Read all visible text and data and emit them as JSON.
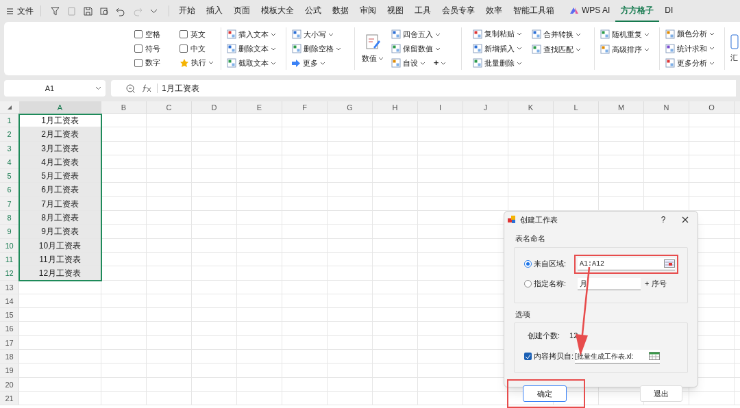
{
  "menu": {
    "file": "文件",
    "tabs": [
      {
        "label": "开始",
        "selected": false
      },
      {
        "label": "插入",
        "selected": false
      },
      {
        "label": "页面",
        "selected": false
      },
      {
        "label": "模板大全",
        "selected": false
      },
      {
        "label": "公式",
        "selected": false
      },
      {
        "label": "数据",
        "selected": false
      },
      {
        "label": "审阅",
        "selected": false
      },
      {
        "label": "视图",
        "selected": false
      },
      {
        "label": "工具",
        "selected": false
      },
      {
        "label": "会员专享",
        "selected": false
      },
      {
        "label": "效率",
        "selected": false
      },
      {
        "label": "智能工具箱",
        "selected": false
      },
      {
        "label": "WPS AI",
        "selected": false
      },
      {
        "label": "方方格子",
        "selected": true
      },
      {
        "label": "DI",
        "selected": false
      }
    ]
  },
  "ribbon": {
    "checkboxes": [
      {
        "label": "空格",
        "checked": false
      },
      {
        "label": "符号",
        "checked": false
      },
      {
        "label": "数字",
        "checked": false
      },
      {
        "label": "英文",
        "checked": false
      },
      {
        "label": "中文",
        "checked": false
      }
    ],
    "execute": "执行",
    "text_tools": [
      [
        "插入文本",
        "删除文本",
        "截取文本"
      ],
      [
        "大小写",
        "删除空格",
        "更多"
      ]
    ],
    "number_button": "数值",
    "number_tools": [
      "四舍五入",
      "保留数值",
      "自设"
    ],
    "plus": "+",
    "edit_tools": [
      [
        "复制粘贴",
        "新增插入",
        "批量删除"
      ],
      [
        "合并转换",
        "查找匹配"
      ],
      [
        "随机重复",
        "高级排序"
      ],
      [
        "颜色分析",
        "统计求和",
        "更多分析"
      ]
    ],
    "summary": "汇"
  },
  "formula_bar": {
    "name_box": "A1",
    "formula": "1月工资表"
  },
  "sheet": {
    "columns": [
      {
        "label": "A",
        "selected": true
      },
      {
        "label": "B",
        "selected": false
      },
      {
        "label": "C",
        "selected": false
      },
      {
        "label": "D",
        "selected": false
      },
      {
        "label": "E",
        "selected": false
      },
      {
        "label": "F",
        "selected": false
      },
      {
        "label": "G",
        "selected": false
      },
      {
        "label": "H",
        "selected": false
      },
      {
        "label": "I",
        "selected": false
      },
      {
        "label": "J",
        "selected": false
      },
      {
        "label": "K",
        "selected": false
      },
      {
        "label": "L",
        "selected": false
      },
      {
        "label": "M",
        "selected": false
      },
      {
        "label": "N",
        "selected": false
      },
      {
        "label": "O",
        "selected": false
      }
    ],
    "rows": [
      {
        "label": "1",
        "selected": true,
        "value": "1月工资表"
      },
      {
        "label": "2",
        "selected": true,
        "value": "2月工资表"
      },
      {
        "label": "3",
        "selected": true,
        "value": "3月工资表"
      },
      {
        "label": "4",
        "selected": true,
        "value": "4月工资表"
      },
      {
        "label": "5",
        "selected": true,
        "value": "5月工资表"
      },
      {
        "label": "6",
        "selected": true,
        "value": "6月工资表"
      },
      {
        "label": "7",
        "selected": true,
        "value": "7月工资表"
      },
      {
        "label": "8",
        "selected": true,
        "value": "8月工资表"
      },
      {
        "label": "9",
        "selected": true,
        "value": "9月工资表"
      },
      {
        "label": "10",
        "selected": true,
        "value": "10月工资表"
      },
      {
        "label": "11",
        "selected": true,
        "value": "11月工资表"
      },
      {
        "label": "12",
        "selected": true,
        "value": "12月工资表"
      },
      {
        "label": "13",
        "selected": false
      },
      {
        "label": "14",
        "selected": false
      },
      {
        "label": "15",
        "selected": false
      },
      {
        "label": "16",
        "selected": false
      },
      {
        "label": "17",
        "selected": false
      },
      {
        "label": "18",
        "selected": false
      },
      {
        "label": "19",
        "selected": false
      },
      {
        "label": "20",
        "selected": false
      },
      {
        "label": "21",
        "selected": false
      }
    ]
  },
  "dialog": {
    "title": "创建工作表",
    "help": "?",
    "naming_group": "表名命名",
    "from_range": {
      "label": "来自区域:",
      "value": "A1:A12",
      "selected": true
    },
    "fixed_name": {
      "label": "指定名称:",
      "value": "月",
      "suffix": "+ 序号",
      "selected": false
    },
    "options_group": "选项",
    "count_label": "创建个数:",
    "count": "12",
    "copy_from": {
      "label": "内容拷贝自:",
      "value": "[批量生成工作表.xl:",
      "checked": true
    },
    "buttons": [
      "确定",
      "退出"
    ]
  }
}
